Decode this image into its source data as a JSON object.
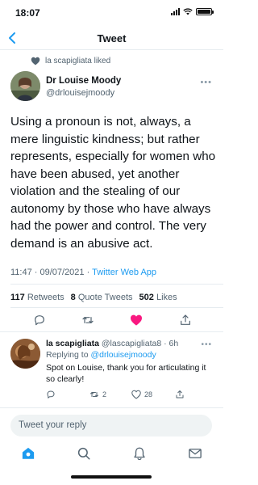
{
  "status_bar": {
    "time": "18:07"
  },
  "nav": {
    "title": "Tweet",
    "back_icon": "chevron-left-icon"
  },
  "social_context": {
    "icon": "heart-icon",
    "text": "la scapigliata liked"
  },
  "tweet": {
    "author_name": "Dr Louise Moody",
    "author_handle": "@drlouisejmoody",
    "text": "Using a pronoun is not, always, a mere linguistic kindness; but rather represents, especially for women who have been abused, yet another violation and the stealing of our autonomy by those who have always had the power and control. The very demand is an abusive act.",
    "timestamp": "11:47 · 09/07/2021 · ",
    "source": "Twitter Web App",
    "stats": {
      "retweets_count": "117",
      "retweets_label": "Retweets",
      "quotes_count": "8",
      "quotes_label": "Quote Tweets",
      "likes_count": "502",
      "likes_label": "Likes"
    },
    "liked": true
  },
  "reply": {
    "author_name": "la scapigliata",
    "author_handle_time": "@lascapigliata8 · 6h",
    "replying_to_label": "Replying to ",
    "replying_to_mention": "@drlouisejmoody",
    "text": "Spot on Louise, thank you for articulating it so clearly!",
    "retweets": "2",
    "likes": "28"
  },
  "composer": {
    "placeholder": "Tweet your reply"
  },
  "tab_bar": {
    "items": [
      "home-icon",
      "search-icon",
      "notifications-icon",
      "messages-icon"
    ]
  },
  "colors": {
    "accent": "#1d9bf0",
    "like": "#f91880",
    "text": "#0f1419",
    "secondary": "#536471"
  }
}
